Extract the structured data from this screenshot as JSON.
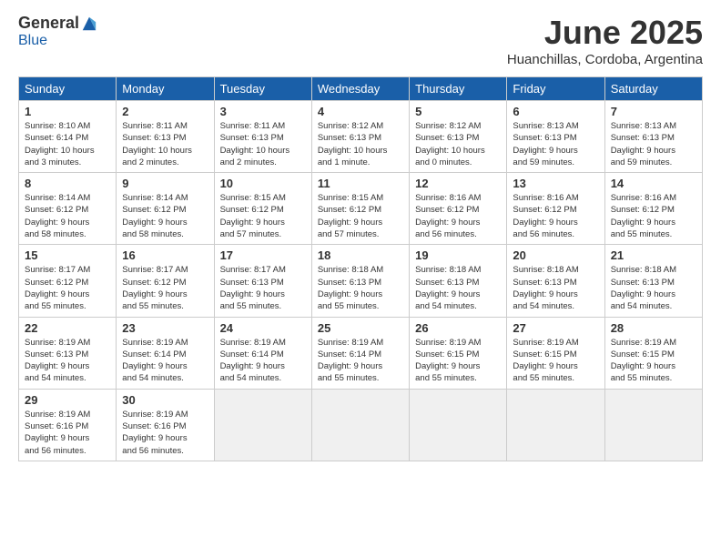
{
  "logo": {
    "general": "General",
    "blue": "Blue"
  },
  "title": "June 2025",
  "subtitle": "Huanchillas, Cordoba, Argentina",
  "headers": [
    "Sunday",
    "Monday",
    "Tuesday",
    "Wednesday",
    "Thursday",
    "Friday",
    "Saturday"
  ],
  "weeks": [
    [
      {
        "day": "1",
        "info": "Sunrise: 8:10 AM\nSunset: 6:14 PM\nDaylight: 10 hours\nand 3 minutes."
      },
      {
        "day": "2",
        "info": "Sunrise: 8:11 AM\nSunset: 6:13 PM\nDaylight: 10 hours\nand 2 minutes."
      },
      {
        "day": "3",
        "info": "Sunrise: 8:11 AM\nSunset: 6:13 PM\nDaylight: 10 hours\nand 2 minutes."
      },
      {
        "day": "4",
        "info": "Sunrise: 8:12 AM\nSunset: 6:13 PM\nDaylight: 10 hours\nand 1 minute."
      },
      {
        "day": "5",
        "info": "Sunrise: 8:12 AM\nSunset: 6:13 PM\nDaylight: 10 hours\nand 0 minutes."
      },
      {
        "day": "6",
        "info": "Sunrise: 8:13 AM\nSunset: 6:13 PM\nDaylight: 9 hours\nand 59 minutes."
      },
      {
        "day": "7",
        "info": "Sunrise: 8:13 AM\nSunset: 6:13 PM\nDaylight: 9 hours\nand 59 minutes."
      }
    ],
    [
      {
        "day": "8",
        "info": "Sunrise: 8:14 AM\nSunset: 6:12 PM\nDaylight: 9 hours\nand 58 minutes."
      },
      {
        "day": "9",
        "info": "Sunrise: 8:14 AM\nSunset: 6:12 PM\nDaylight: 9 hours\nand 58 minutes."
      },
      {
        "day": "10",
        "info": "Sunrise: 8:15 AM\nSunset: 6:12 PM\nDaylight: 9 hours\nand 57 minutes."
      },
      {
        "day": "11",
        "info": "Sunrise: 8:15 AM\nSunset: 6:12 PM\nDaylight: 9 hours\nand 57 minutes."
      },
      {
        "day": "12",
        "info": "Sunrise: 8:16 AM\nSunset: 6:12 PM\nDaylight: 9 hours\nand 56 minutes."
      },
      {
        "day": "13",
        "info": "Sunrise: 8:16 AM\nSunset: 6:12 PM\nDaylight: 9 hours\nand 56 minutes."
      },
      {
        "day": "14",
        "info": "Sunrise: 8:16 AM\nSunset: 6:12 PM\nDaylight: 9 hours\nand 55 minutes."
      }
    ],
    [
      {
        "day": "15",
        "info": "Sunrise: 8:17 AM\nSunset: 6:12 PM\nDaylight: 9 hours\nand 55 minutes."
      },
      {
        "day": "16",
        "info": "Sunrise: 8:17 AM\nSunset: 6:12 PM\nDaylight: 9 hours\nand 55 minutes."
      },
      {
        "day": "17",
        "info": "Sunrise: 8:17 AM\nSunset: 6:13 PM\nDaylight: 9 hours\nand 55 minutes."
      },
      {
        "day": "18",
        "info": "Sunrise: 8:18 AM\nSunset: 6:13 PM\nDaylight: 9 hours\nand 55 minutes."
      },
      {
        "day": "19",
        "info": "Sunrise: 8:18 AM\nSunset: 6:13 PM\nDaylight: 9 hours\nand 54 minutes."
      },
      {
        "day": "20",
        "info": "Sunrise: 8:18 AM\nSunset: 6:13 PM\nDaylight: 9 hours\nand 54 minutes."
      },
      {
        "day": "21",
        "info": "Sunrise: 8:18 AM\nSunset: 6:13 PM\nDaylight: 9 hours\nand 54 minutes."
      }
    ],
    [
      {
        "day": "22",
        "info": "Sunrise: 8:19 AM\nSunset: 6:13 PM\nDaylight: 9 hours\nand 54 minutes."
      },
      {
        "day": "23",
        "info": "Sunrise: 8:19 AM\nSunset: 6:14 PM\nDaylight: 9 hours\nand 54 minutes."
      },
      {
        "day": "24",
        "info": "Sunrise: 8:19 AM\nSunset: 6:14 PM\nDaylight: 9 hours\nand 54 minutes."
      },
      {
        "day": "25",
        "info": "Sunrise: 8:19 AM\nSunset: 6:14 PM\nDaylight: 9 hours\nand 55 minutes."
      },
      {
        "day": "26",
        "info": "Sunrise: 8:19 AM\nSunset: 6:15 PM\nDaylight: 9 hours\nand 55 minutes."
      },
      {
        "day": "27",
        "info": "Sunrise: 8:19 AM\nSunset: 6:15 PM\nDaylight: 9 hours\nand 55 minutes."
      },
      {
        "day": "28",
        "info": "Sunrise: 8:19 AM\nSunset: 6:15 PM\nDaylight: 9 hours\nand 55 minutes."
      }
    ],
    [
      {
        "day": "29",
        "info": "Sunrise: 8:19 AM\nSunset: 6:16 PM\nDaylight: 9 hours\nand 56 minutes."
      },
      {
        "day": "30",
        "info": "Sunrise: 8:19 AM\nSunset: 6:16 PM\nDaylight: 9 hours\nand 56 minutes."
      },
      {
        "day": "",
        "info": ""
      },
      {
        "day": "",
        "info": ""
      },
      {
        "day": "",
        "info": ""
      },
      {
        "day": "",
        "info": ""
      },
      {
        "day": "",
        "info": ""
      }
    ]
  ]
}
